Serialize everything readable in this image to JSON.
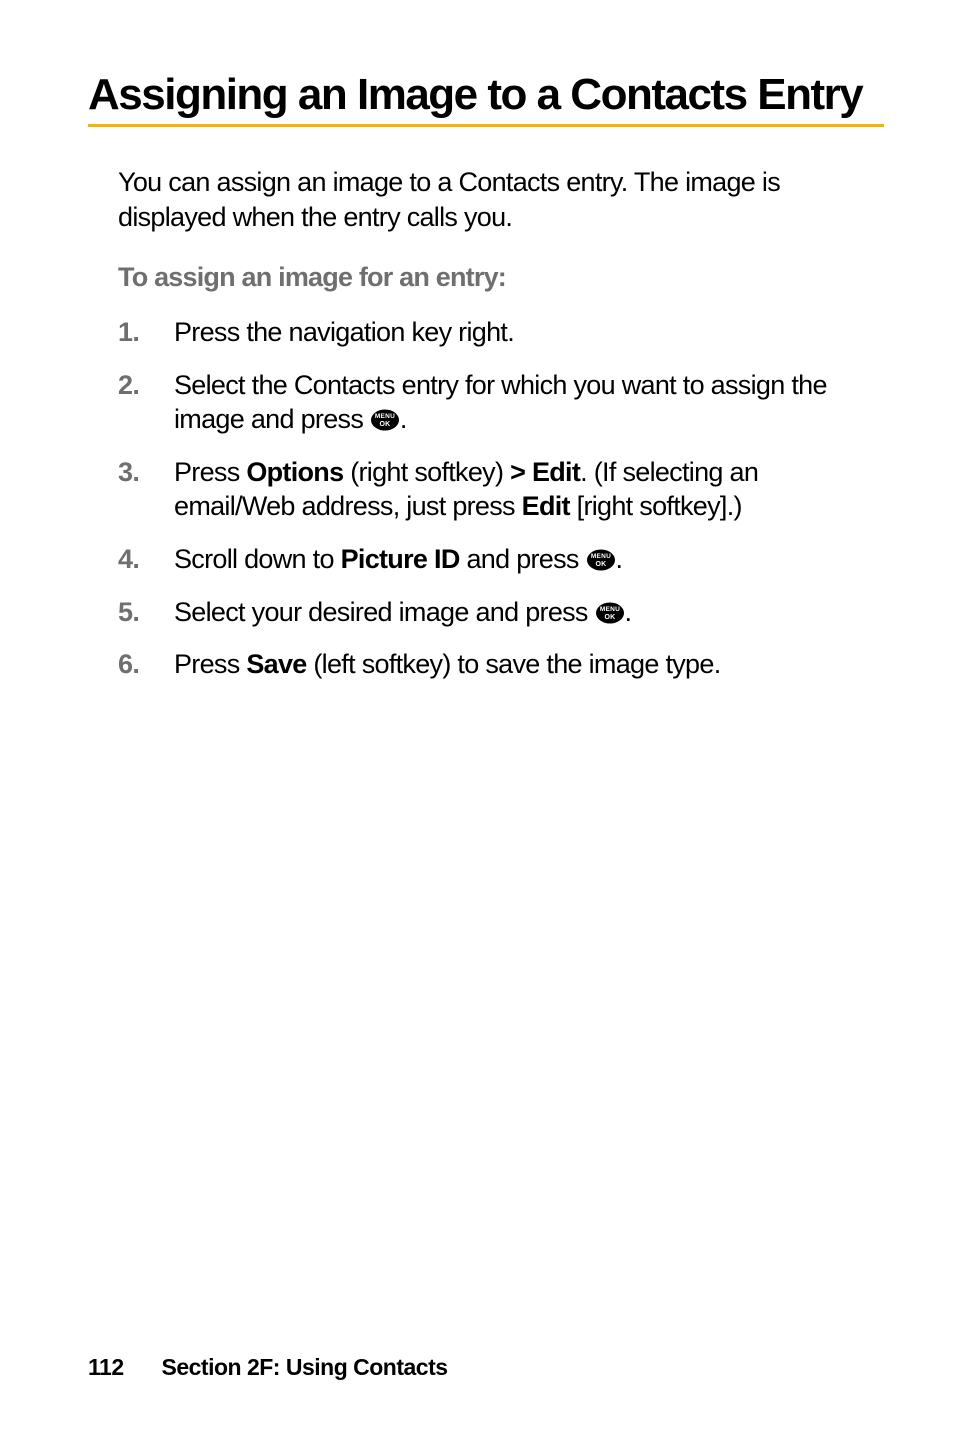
{
  "title": "Assigning an Image to a Contacts Entry",
  "intro": "You can assign an image to a Contacts entry. The image is displayed when the entry calls you.",
  "subhead": "To assign an image for an entry:",
  "steps": [
    {
      "parts": [
        {
          "t": "Press the navigation key right."
        }
      ]
    },
    {
      "parts": [
        {
          "t": "Select the Contacts entry for which you want to assign the image and press "
        },
        {
          "icon": "menu-ok"
        },
        {
          "t": "."
        }
      ]
    },
    {
      "parts": [
        {
          "t": "Press "
        },
        {
          "b": "Options"
        },
        {
          "t": " (right softkey) "
        },
        {
          "b": "> Edit"
        },
        {
          "t": ". (If selecting an email/Web address, just press "
        },
        {
          "b": "Edit"
        },
        {
          "t": " [right softkey].)"
        }
      ]
    },
    {
      "parts": [
        {
          "t": "Scroll down to "
        },
        {
          "b": "Picture ID"
        },
        {
          "t": " and press "
        },
        {
          "icon": "menu-ok"
        },
        {
          "t": "."
        }
      ]
    },
    {
      "parts": [
        {
          "t": "Select your desired image and press "
        },
        {
          "icon": "menu-ok"
        },
        {
          "t": "."
        }
      ]
    },
    {
      "parts": [
        {
          "t": "Press "
        },
        {
          "b": "Save"
        },
        {
          "t": " (left softkey) to save the image type."
        }
      ]
    }
  ],
  "icon_label": {
    "top": "MENU",
    "bottom": "OK"
  },
  "footer": {
    "page": "112",
    "section": "Section 2F: Using Contacts"
  }
}
